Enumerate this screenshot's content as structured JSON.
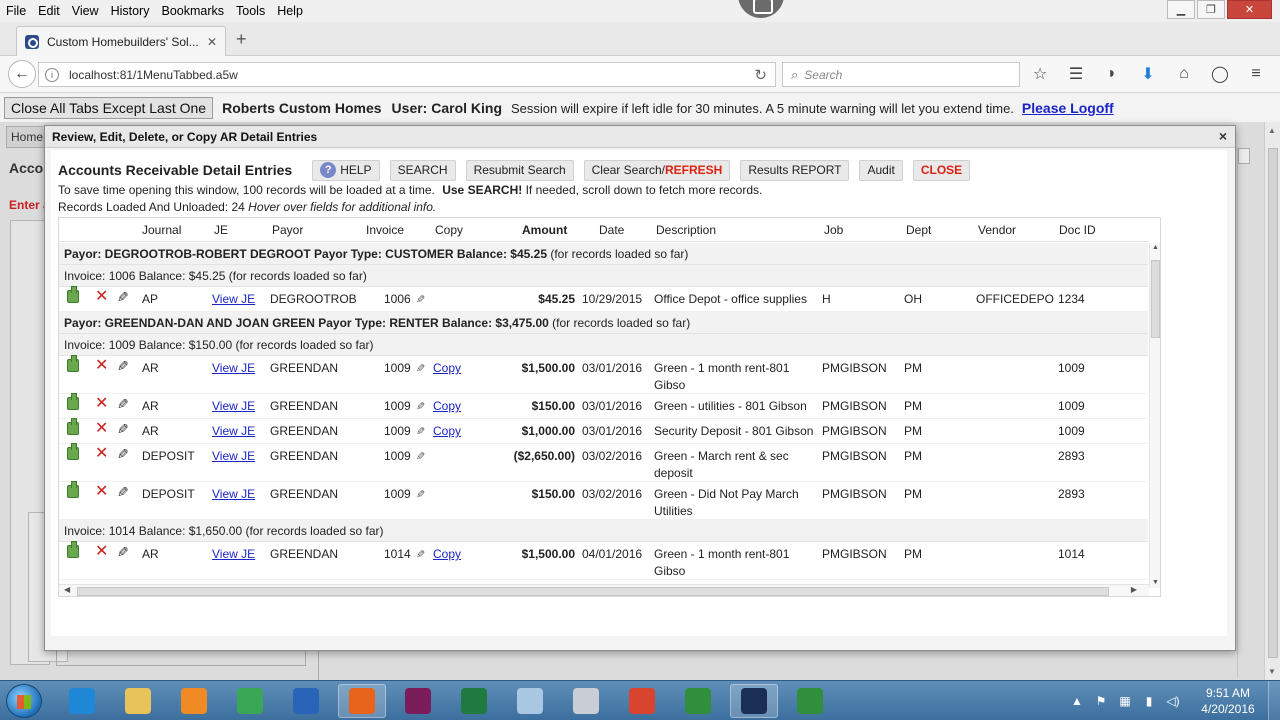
{
  "browser": {
    "menu": [
      "File",
      "Edit",
      "View",
      "History",
      "Bookmarks",
      "Tools",
      "Help"
    ],
    "tab_title": "Custom Homebuilders' Sol...",
    "url": "localhost:81/1MenuTabbed.a5w",
    "search_placeholder": "Search",
    "window_controls": [
      "minimize-icon",
      "restore-icon",
      "close-icon"
    ]
  },
  "appbar": {
    "close_tabs_label": "Close All Tabs Except Last One",
    "company": "Roberts Custom Homes",
    "user": "User: Carol King",
    "session_text": "Session will expire if left idle for 30 minutes.   A 5 minute warning will let you extend time.",
    "logoff_label": "Please Logoff"
  },
  "background": {
    "home_tab": "Home",
    "title": "Acco",
    "red_text": "Enter a"
  },
  "modal": {
    "title": "Review, Edit, Delete, or Copy AR Detail Entries",
    "close_icon": "×",
    "toolbar": {
      "title": "Accounts Receivable Detail Entries",
      "help": "HELP",
      "search": "SEARCH",
      "resubmit": "Resubmit Search",
      "clear_search": "Clear Search/",
      "refresh": "REFRESH",
      "results_report": "Results REPORT",
      "audit": "Audit",
      "close": "CLOSE"
    },
    "info_line1": "To save time opening this window, 100 records will be loaded at a time.",
    "info_line1_bold": "Use SEARCH!",
    "info_line1_tail": " If needed, scroll down to fetch more records.",
    "info_line2": "Records Loaded And Unloaded: 24 ",
    "info_line2_hint": "Hover over fields for additional info.",
    "columns": [
      "Journal",
      "JE",
      "Payor",
      "Invoice",
      "Copy",
      "Amount",
      "Date",
      "Description",
      "Job",
      "Dept",
      "Vendor",
      "Doc ID"
    ],
    "payor1": {
      "label": "Payor: DEGROOTROB-ROBERT DEGROOT Payor Type: CUSTOMER Balance: $45.25",
      "suffix": " (for records loaded so far)"
    },
    "invoice1": "Invoice: 1006 Balance: $45.25 (for records loaded so far)",
    "rows1": [
      {
        "journal": "AP",
        "je": "View JE",
        "payor": "DEGROOTROB",
        "invoice": "1006",
        "copy": "",
        "amount": "$45.25",
        "date": "10/29/2015",
        "desc1": "Office Depot - office supplies",
        "desc2": "",
        "job": "H",
        "dept": "OH",
        "vendor": "OFFICEDEPO",
        "doc": "1234"
      }
    ],
    "payor2": {
      "label": "Payor: GREENDAN-DAN AND JOAN GREEN Payor Type: RENTER Balance: $3,475.00",
      "suffix": " (for records loaded so far)"
    },
    "invoice2": "Invoice: 1009 Balance: $150.00 (for records loaded so far)",
    "rows2": [
      {
        "journal": "AR",
        "je": "View JE",
        "payor": "GREENDAN",
        "invoice": "1009",
        "copy": "Copy",
        "amount": "$1,500.00",
        "date": "03/01/2016",
        "desc1": "Green - 1 month rent-801",
        "desc2": "Gibso",
        "job": "PMGIBSON",
        "dept": "PM",
        "vendor": "",
        "doc": "1009"
      },
      {
        "journal": "AR",
        "je": "View JE",
        "payor": "GREENDAN",
        "invoice": "1009",
        "copy": "Copy",
        "amount": "$150.00",
        "date": "03/01/2016",
        "desc1": "Green - utilities - 801 Gibson",
        "desc2": "",
        "job": "PMGIBSON",
        "dept": "PM",
        "vendor": "",
        "doc": "1009"
      },
      {
        "journal": "AR",
        "je": "View JE",
        "payor": "GREENDAN",
        "invoice": "1009",
        "copy": "Copy",
        "amount": "$1,000.00",
        "date": "03/01/2016",
        "desc1": "Security Deposit - 801 Gibson",
        "desc2": "",
        "job": "PMGIBSON",
        "dept": "PM",
        "vendor": "",
        "doc": "1009"
      },
      {
        "journal": "DEPOSIT",
        "je": "View JE",
        "payor": "GREENDAN",
        "invoice": "1009",
        "copy": "",
        "amount": "($2,650.00)",
        "date": "03/02/2016",
        "desc1": "Green - March rent & sec",
        "desc2": "deposit",
        "job": "PMGIBSON",
        "dept": "PM",
        "vendor": "",
        "doc": "2893"
      },
      {
        "journal": "DEPOSIT",
        "je": "View JE",
        "payor": "GREENDAN",
        "invoice": "1009",
        "copy": "",
        "amount": "$150.00",
        "date": "03/02/2016",
        "desc1": "Green - Did Not Pay March",
        "desc2": "Utilities",
        "job": "PMGIBSON",
        "dept": "PM",
        "vendor": "",
        "doc": "2893"
      }
    ],
    "invoice3": "Invoice: 1014 Balance: $1,650.00 (for records loaded so far)",
    "rows3": [
      {
        "journal": "AR",
        "je": "View JE",
        "payor": "GREENDAN",
        "invoice": "1014",
        "copy": "Copy",
        "amount": "$1,500.00",
        "date": "04/01/2016",
        "desc1": "Green - 1 month rent-801",
        "desc2": "Gibso",
        "job": "PMGIBSON",
        "dept": "PM",
        "vendor": "",
        "doc": "1014"
      }
    ]
  },
  "taskbar": {
    "apps": [
      {
        "name": "ie-icon",
        "color": "#1e88d6"
      },
      {
        "name": "explorer-icon",
        "color": "#e8c25a"
      },
      {
        "name": "media-player-icon",
        "color": "#f08a24"
      },
      {
        "name": "chrome-icon",
        "color": "#3aa757"
      },
      {
        "name": "outlook-icon",
        "color": "#2a64b8"
      },
      {
        "name": "firefox-icon",
        "color": "#e8631c"
      },
      {
        "name": "powershell-icon",
        "color": "#7a1d5a"
      },
      {
        "name": "excel-icon",
        "color": "#1f7a3f"
      },
      {
        "name": "notepad-icon",
        "color": "#a9c7e3"
      },
      {
        "name": "calculator-icon",
        "color": "#c9ced6"
      },
      {
        "name": "cc4-icon",
        "color": "#d9442e"
      },
      {
        "name": "camtasia-icon",
        "color": "#2f8f3a"
      },
      {
        "name": "alpha-icon",
        "color": "#1b2e54"
      },
      {
        "name": "camtasia2-icon",
        "color": "#2f8f3a"
      }
    ],
    "time": "9:51 AM",
    "date": "4/20/2016"
  }
}
